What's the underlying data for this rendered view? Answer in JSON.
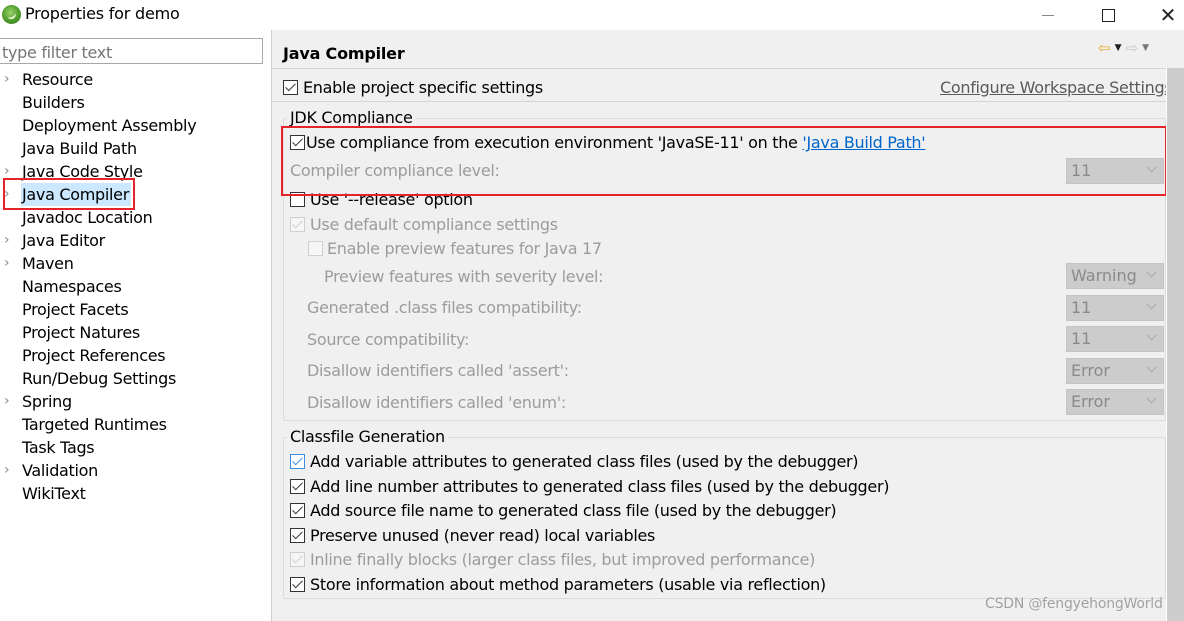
{
  "window": {
    "title": "Properties for demo",
    "controls": {
      "minimize": "—",
      "maximize": "☐",
      "close": "✕"
    }
  },
  "filter": {
    "placeholder": "type filter text",
    "value": ""
  },
  "tree": {
    "items": [
      {
        "label": "Resource",
        "expandable": true,
        "selected": false
      },
      {
        "label": "Builders",
        "expandable": false,
        "selected": false
      },
      {
        "label": "Deployment Assembly",
        "expandable": false,
        "selected": false
      },
      {
        "label": "Java Build Path",
        "expandable": false,
        "selected": false
      },
      {
        "label": "Java Code Style",
        "expandable": true,
        "selected": false
      },
      {
        "label": "Java Compiler",
        "expandable": true,
        "selected": true
      },
      {
        "label": "Javadoc Location",
        "expandable": false,
        "selected": false
      },
      {
        "label": "Java Editor",
        "expandable": true,
        "selected": false
      },
      {
        "label": "Maven",
        "expandable": true,
        "selected": false
      },
      {
        "label": "Namespaces",
        "expandable": false,
        "selected": false
      },
      {
        "label": "Project Facets",
        "expandable": false,
        "selected": false
      },
      {
        "label": "Project Natures",
        "expandable": false,
        "selected": false
      },
      {
        "label": "Project References",
        "expandable": false,
        "selected": false
      },
      {
        "label": "Run/Debug Settings",
        "expandable": false,
        "selected": false
      },
      {
        "label": "Spring",
        "expandable": true,
        "selected": false
      },
      {
        "label": "Targeted Runtimes",
        "expandable": false,
        "selected": false
      },
      {
        "label": "Task Tags",
        "expandable": false,
        "selected": false
      },
      {
        "label": "Validation",
        "expandable": true,
        "selected": false
      },
      {
        "label": "WikiText",
        "expandable": false,
        "selected": false
      }
    ],
    "chevron_glyph": "›"
  },
  "page": {
    "title": "Java Compiler",
    "nav": {
      "back": "⇦",
      "forward": "⇨",
      "dropdown": "▼"
    },
    "enable_project_settings": {
      "label": "Enable project specific settings",
      "checked": true
    },
    "configure_workspace_link": "Configure Workspace Settings...",
    "jdk_compliance": {
      "title": "JDK Compliance",
      "use_ee_compliance": {
        "label_prefix": "Use compliance from execution environment 'JavaSE-11' on the ",
        "link": "'Java Build Path'",
        "checked": true
      },
      "compiler_compliance_label": "Compiler compliance level:",
      "compiler_compliance_value": "11",
      "use_release": {
        "label": "Use '--release' option",
        "checked": false
      },
      "use_default_compliance": {
        "label": "Use default compliance settings",
        "checked": true,
        "enabled": false
      },
      "enable_preview": {
        "label": "Enable preview features for Java 17",
        "checked": false,
        "enabled": false
      },
      "preview_severity_label": "Preview features with severity level:",
      "preview_severity_value": "Warning",
      "generated_class_label": "Generated .class files compatibility:",
      "generated_class_value": "11",
      "source_compat_label": "Source compatibility:",
      "source_compat_value": "11",
      "assert_label": "Disallow identifiers called 'assert':",
      "assert_value": "Error",
      "enum_label": "Disallow identifiers called 'enum':",
      "enum_value": "Error"
    },
    "classfile_generation": {
      "title": "Classfile Generation",
      "options": [
        {
          "label": "Add variable attributes to generated class files (used by the debugger)",
          "checked": true,
          "enabled": true,
          "focused": true
        },
        {
          "label": "Add line number attributes to generated class files (used by the debugger)",
          "checked": true,
          "enabled": true,
          "focused": false
        },
        {
          "label": "Add source file name to generated class file (used by the debugger)",
          "checked": true,
          "enabled": true,
          "focused": false
        },
        {
          "label": "Preserve unused (never read) local variables",
          "checked": true,
          "enabled": true,
          "focused": false
        },
        {
          "label": "Inline finally blocks (larger class files, but improved performance)",
          "checked": true,
          "enabled": false,
          "focused": false
        },
        {
          "label": "Store information about method parameters (usable via reflection)",
          "checked": true,
          "enabled": true,
          "focused": false
        }
      ]
    }
  },
  "watermark": "CSDN @fengyehongWorld",
  "colors": {
    "highlight_box": "#e5232a",
    "selection": "#cce8ff",
    "link": "#0066cc"
  }
}
